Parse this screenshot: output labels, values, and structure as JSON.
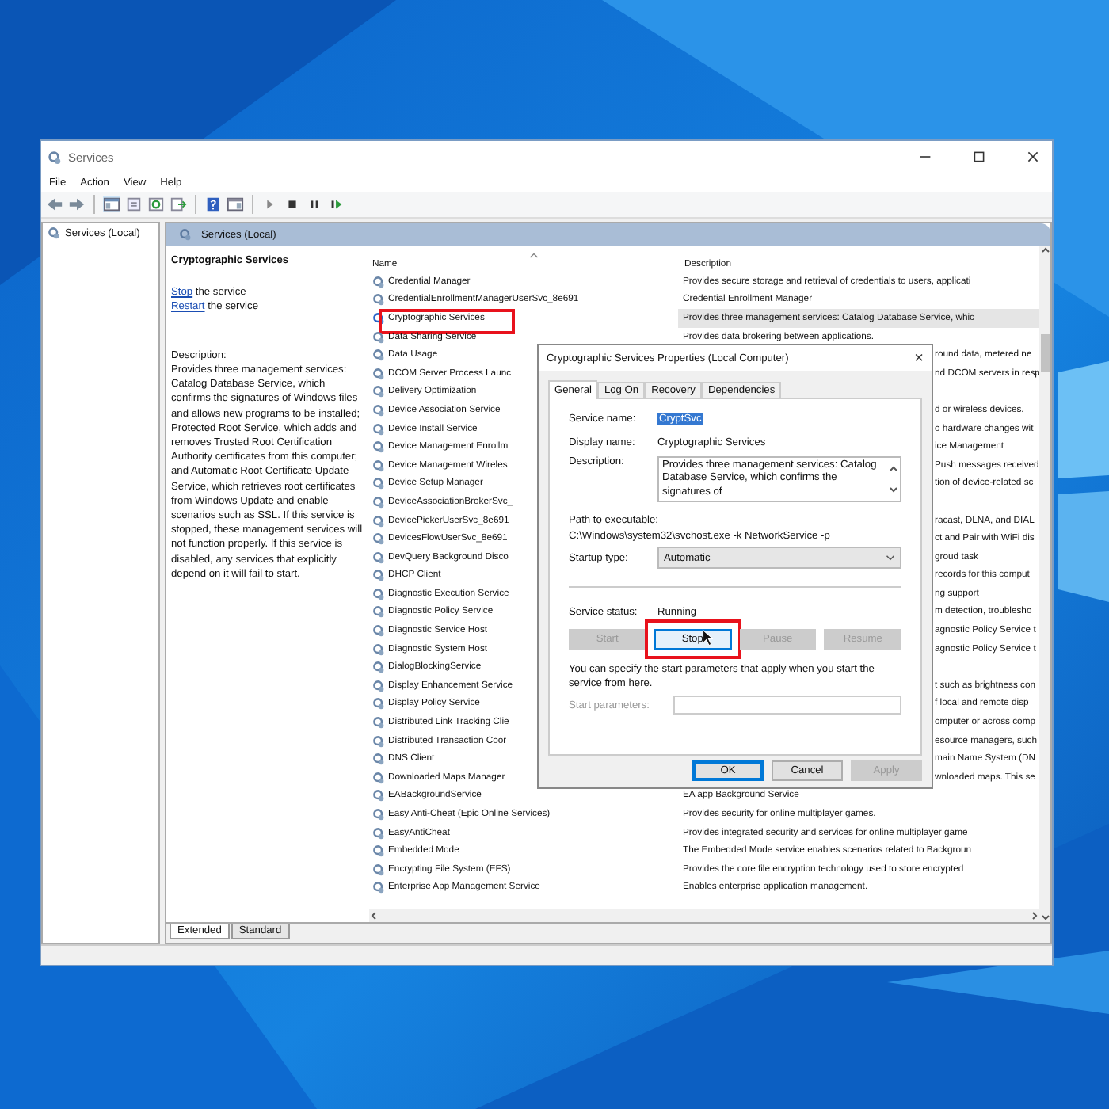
{
  "window": {
    "title": "Services"
  },
  "menu": [
    "File",
    "Action",
    "View",
    "Help"
  ],
  "tree": {
    "items": [
      {
        "label": "Services (Local)"
      }
    ]
  },
  "pane_header": "Services (Local)",
  "detail": {
    "title": "Cryptographic Services",
    "actions": [
      {
        "link": "Stop",
        "text": " the service"
      },
      {
        "link": "Restart",
        "text": " the service"
      }
    ],
    "description_label": "Description:",
    "description": "Provides three management services: Catalog Database Service, which confirms the signatures of Windows files and allows new programs to be installed; Protected Root Service, which adds and removes Trusted Root Certification Authority certificates from this computer; and Automatic Root Certificate Update Service, which retrieves root certificates from Windows Update and enable scenarios such as SSL. If this service is stopped, these management services will not function properly. If this service is disabled, any services that explicitly depend on it will fail to start."
  },
  "table": {
    "columns": [
      "Name",
      "Description"
    ],
    "rows": [
      {
        "name": "Credential Manager",
        "description": "Provides secure storage and retrieval of credentials to users, applicati",
        "selected": false,
        "highlighted": false,
        "covered": false
      },
      {
        "name": "CredentialEnrollmentManagerUserSvc_8e691",
        "description": "Credential Enrollment Manager",
        "selected": false,
        "highlighted": false,
        "covered": false
      },
      {
        "name": "Cryptographic Services",
        "description": "Provides three management services: Catalog Database Service, whic",
        "selected": true,
        "highlighted": true,
        "covered": false
      },
      {
        "name": "Data Sharing Service",
        "description": "Provides data brokering between applications.",
        "selected": false,
        "highlighted": false,
        "covered": false
      },
      {
        "name": "Data Usage",
        "description": "round data, metered ne",
        "selected": false,
        "highlighted": false,
        "covered": true
      },
      {
        "name": "DCOM Server Process Launc",
        "description": "nd DCOM servers in resp",
        "selected": false,
        "highlighted": false,
        "covered": true
      },
      {
        "name": "Delivery Optimization",
        "selected": false,
        "highlighted": false
      },
      {
        "name": "Device Association Service",
        "description": "d or wireless devices.",
        "selected": false,
        "highlighted": false,
        "covered": true
      },
      {
        "name": "Device Install Service",
        "description": "o hardware changes wit",
        "selected": false,
        "highlighted": false,
        "covered": true
      },
      {
        "name": "Device Management Enrollm",
        "description": "ice Management",
        "selected": false,
        "highlighted": false,
        "covered": true
      },
      {
        "name": "Device Management Wireles",
        "description": "Push messages received",
        "selected": false,
        "highlighted": false,
        "covered": true
      },
      {
        "name": "Device Setup Manager",
        "description": "tion of device-related sc",
        "selected": false,
        "highlighted": false,
        "covered": true
      },
      {
        "name": "DeviceAssociationBrokerSvc_",
        "selected": false,
        "highlighted": false
      },
      {
        "name": "DevicePickerUserSvc_8e691",
        "description": "racast, DLNA, and DIAL",
        "selected": false,
        "highlighted": false,
        "covered": true
      },
      {
        "name": "DevicesFlowUserSvc_8e691",
        "description": "ct and Pair with WiFi dis",
        "selected": false,
        "highlighted": false,
        "covered": true
      },
      {
        "name": "DevQuery Background Disco",
        "description": "groud task",
        "selected": false,
        "highlighted": false,
        "covered": true
      },
      {
        "name": "DHCP Client",
        "description": "records for this comput",
        "selected": false,
        "highlighted": false,
        "covered": true
      },
      {
        "name": "Diagnostic Execution Service",
        "description": "ng support",
        "selected": false,
        "highlighted": false,
        "covered": true
      },
      {
        "name": "Diagnostic Policy Service",
        "description": "m detection, troublesho",
        "selected": false,
        "highlighted": false,
        "covered": true
      },
      {
        "name": "Diagnostic Service Host",
        "description": "agnostic Policy Service t",
        "selected": false,
        "highlighted": false,
        "covered": true
      },
      {
        "name": "Diagnostic System Host",
        "description": "agnostic Policy Service t",
        "selected": false,
        "highlighted": false,
        "covered": true
      },
      {
        "name": "DialogBlockingService",
        "selected": false,
        "highlighted": false
      },
      {
        "name": "Display Enhancement Service",
        "description": "t such as brightness con",
        "selected": false,
        "highlighted": false,
        "covered": true
      },
      {
        "name": "Display Policy Service",
        "description": "f local and remote disp",
        "selected": false,
        "highlighted": false,
        "covered": true
      },
      {
        "name": "Distributed Link Tracking Clie",
        "description": "omputer or across comp",
        "selected": false,
        "highlighted": false,
        "covered": true
      },
      {
        "name": "Distributed Transaction Coor",
        "description": "esource managers, such",
        "selected": false,
        "highlighted": false,
        "covered": true
      },
      {
        "name": "DNS Client",
        "description": "main Name System (DN",
        "selected": false,
        "highlighted": false,
        "covered": true
      },
      {
        "name": "Downloaded Maps Manager",
        "description": "wnloaded maps. This se",
        "selected": false,
        "highlighted": false,
        "covered": true
      },
      {
        "name": "EABackgroundService",
        "description": "EA app Background Service",
        "selected": false,
        "highlighted": false,
        "covered": false
      },
      {
        "name": "Easy Anti-Cheat (Epic Online Services)",
        "description": "Provides security for online multiplayer games.",
        "selected": false,
        "highlighted": false,
        "covered": false
      },
      {
        "name": "EasyAntiCheat",
        "description": "Provides integrated security and services for online multiplayer game",
        "selected": false,
        "highlighted": false,
        "covered": false
      },
      {
        "name": "Embedded Mode",
        "description": "The Embedded Mode service enables scenarios related to Backgroun",
        "selected": false,
        "highlighted": false,
        "covered": false
      },
      {
        "name": "Encrypting File System (EFS)",
        "description": "Provides the core file encryption technology used to store encrypted",
        "selected": false,
        "highlighted": false,
        "covered": false
      },
      {
        "name": "Enterprise App Management Service",
        "description": "Enables enterprise application management.",
        "selected": false,
        "highlighted": false,
        "covered": false
      }
    ]
  },
  "view_tabs": [
    {
      "label": "Extended",
      "selected": true
    },
    {
      "label": "Standard",
      "selected": false
    }
  ],
  "dialog": {
    "title": "Cryptographic Services Properties (Local Computer)",
    "close": "×",
    "tabs": [
      {
        "label": "General",
        "selected": true
      },
      {
        "label": "Log On",
        "selected": false
      },
      {
        "label": "Recovery",
        "selected": false
      },
      {
        "label": "Dependencies",
        "selected": false
      }
    ],
    "service_name_label": "Service name:",
    "service_name": "CryptSvc",
    "display_name_label": "Display name:",
    "display_name": "Cryptographic Services",
    "description_label": "Description:",
    "description": "Provides three management services: Catalog Database Service, which confirms the signatures of",
    "path_label": "Path to executable:",
    "path": "C:\\Windows\\system32\\svchost.exe -k NetworkService -p",
    "startup_label": "Startup type:",
    "startup_value": "Automatic",
    "status_label": "Service status:",
    "status": "Running",
    "service_buttons": [
      {
        "label": "Start",
        "disabled": true,
        "highlighted": false
      },
      {
        "label": "Stop",
        "disabled": false,
        "highlighted": true
      },
      {
        "label": "Pause",
        "disabled": true,
        "highlighted": false
      },
      {
        "label": "Resume",
        "disabled": true,
        "highlighted": false
      }
    ],
    "hint": "You can specify the start parameters that apply when you start the service from here.",
    "params_label": "Start parameters:",
    "params_disabled": true,
    "footer_buttons": [
      {
        "label": "OK",
        "disabled": false,
        "default": true
      },
      {
        "label": "Cancel",
        "disabled": false,
        "default": false
      },
      {
        "label": "Apply",
        "disabled": true,
        "default": false
      }
    ]
  }
}
